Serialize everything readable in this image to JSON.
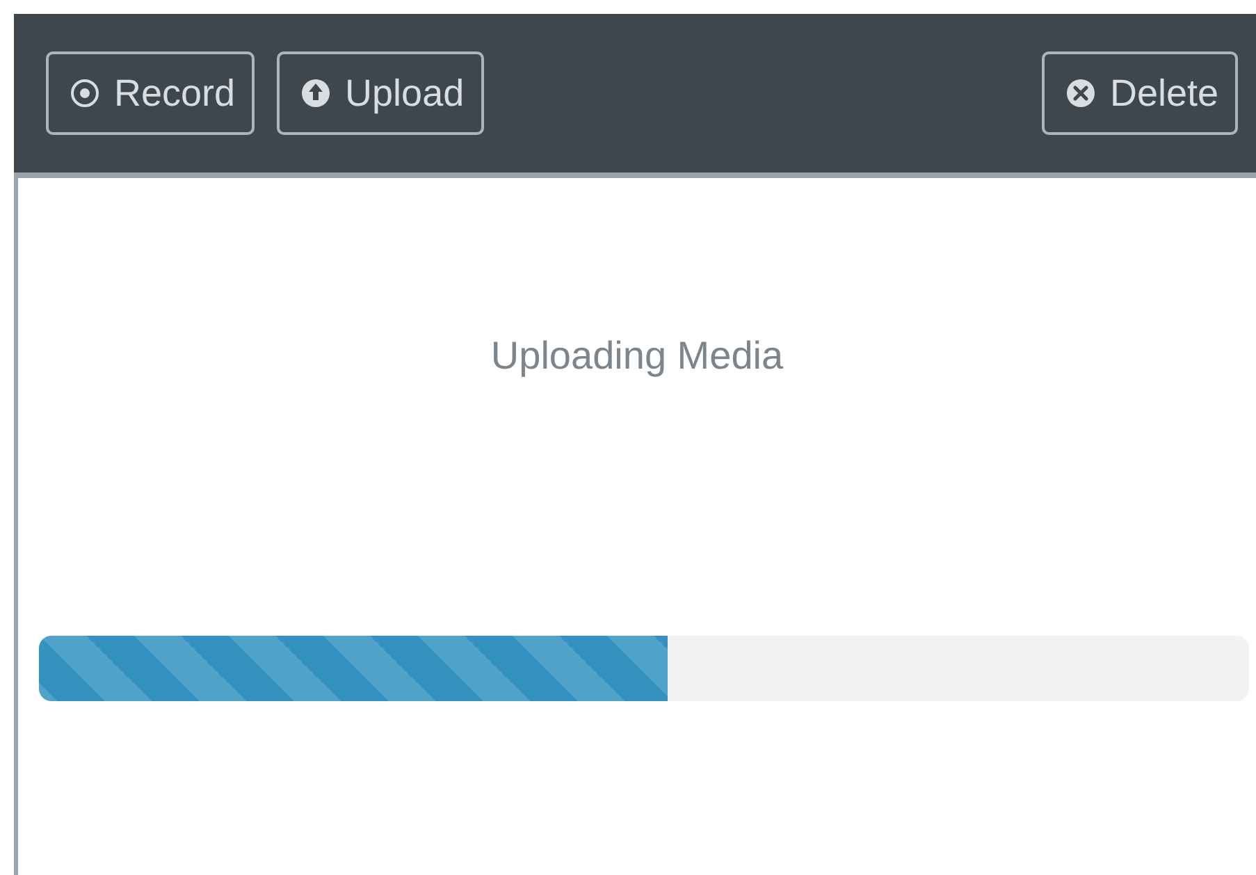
{
  "toolbar": {
    "buttons": [
      {
        "kind": "record",
        "label": "Record"
      },
      {
        "kind": "upload",
        "label": "Upload"
      },
      {
        "kind": "delete",
        "label": "Delete"
      }
    ]
  },
  "status": {
    "message": "Uploading Media"
  },
  "progress": {
    "level": 0.52
  }
}
